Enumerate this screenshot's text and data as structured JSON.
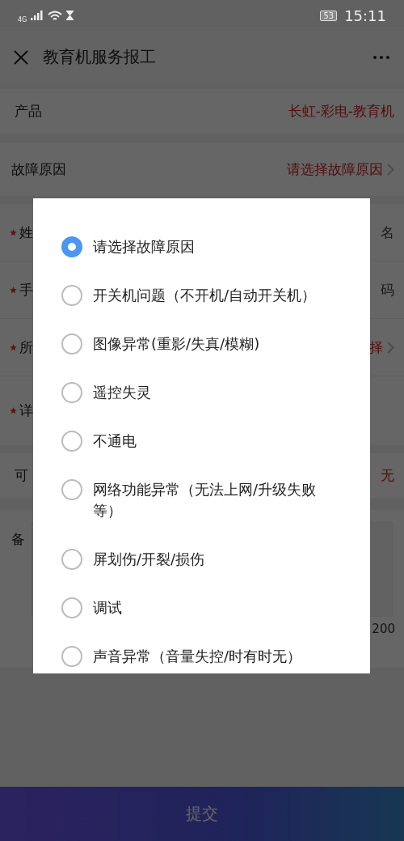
{
  "status_bar": {
    "network": "4G",
    "battery": "53",
    "time": "15:11"
  },
  "header": {
    "title": "教育机服务报工"
  },
  "product": {
    "label": "产品",
    "value": "长虹-彩电-教育机"
  },
  "fault": {
    "label": "故障原因",
    "value": "请选择故障原因"
  },
  "fields": [
    {
      "required": true,
      "label": "姓",
      "value": "名",
      "kind": "text"
    },
    {
      "required": true,
      "label": "手",
      "value": "码",
      "kind": "text"
    },
    {
      "required": true,
      "label": "所",
      "value": "择",
      "kind": "select"
    },
    {
      "required": true,
      "label": "详",
      "kind": "area"
    }
  ],
  "available": {
    "label": "可",
    "value": "无"
  },
  "remarks": {
    "label": "备",
    "counter": "200"
  },
  "dialog": {
    "options": [
      {
        "label": "请选择故障原因",
        "selected": true
      },
      {
        "label": "开关机问题（不开机/自动开关机）",
        "selected": false
      },
      {
        "label": "图像异常(重影/失真/模糊)",
        "selected": false
      },
      {
        "label": "遥控失灵",
        "selected": false
      },
      {
        "label": "不通电",
        "selected": false
      },
      {
        "label": "网络功能异常（无法上网/升级失败等）",
        "selected": false
      },
      {
        "label": "屏划伤/开裂/损伤",
        "selected": false
      },
      {
        "label": "调试",
        "selected": false
      },
      {
        "label": "声音异常（音量失控/时有时无）",
        "selected": false
      }
    ]
  },
  "submit": {
    "label": "提交"
  }
}
